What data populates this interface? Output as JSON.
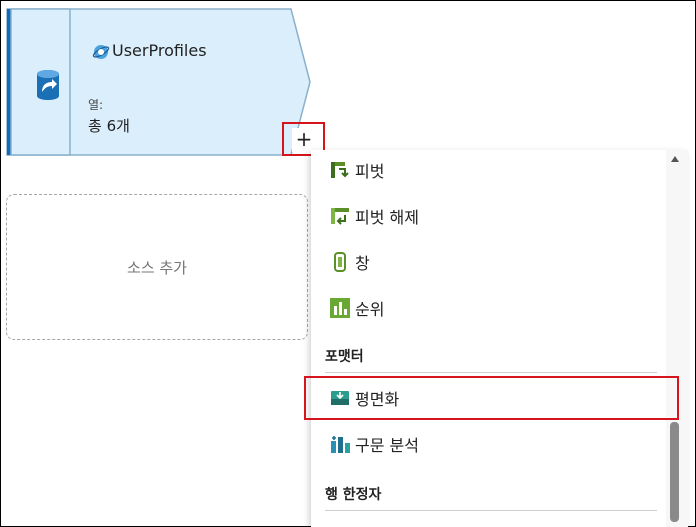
{
  "node": {
    "title": "UserProfiles",
    "columns_label": "열:",
    "columns_value": "총 6개",
    "add_button": "+"
  },
  "add_source": {
    "label": "소스 추가"
  },
  "menu": {
    "items_top": [
      {
        "label": "피벗",
        "icon": "pivot-icon"
      },
      {
        "label": "피벗 해제",
        "icon": "unpivot-icon"
      },
      {
        "label": "창",
        "icon": "window-icon"
      },
      {
        "label": "순위",
        "icon": "rank-icon"
      }
    ],
    "section_formatter": "포맷터",
    "items_formatter": [
      {
        "label": "평면화",
        "icon": "flatten-icon"
      },
      {
        "label": "구문 분석",
        "icon": "parse-icon"
      }
    ],
    "section_row_modifier": "행 한정자"
  },
  "colors": {
    "node_fill": "#dbeefb",
    "node_stroke": "#8ab0cc",
    "accent": "#0f6cbd",
    "highlight": "#d6141c"
  }
}
